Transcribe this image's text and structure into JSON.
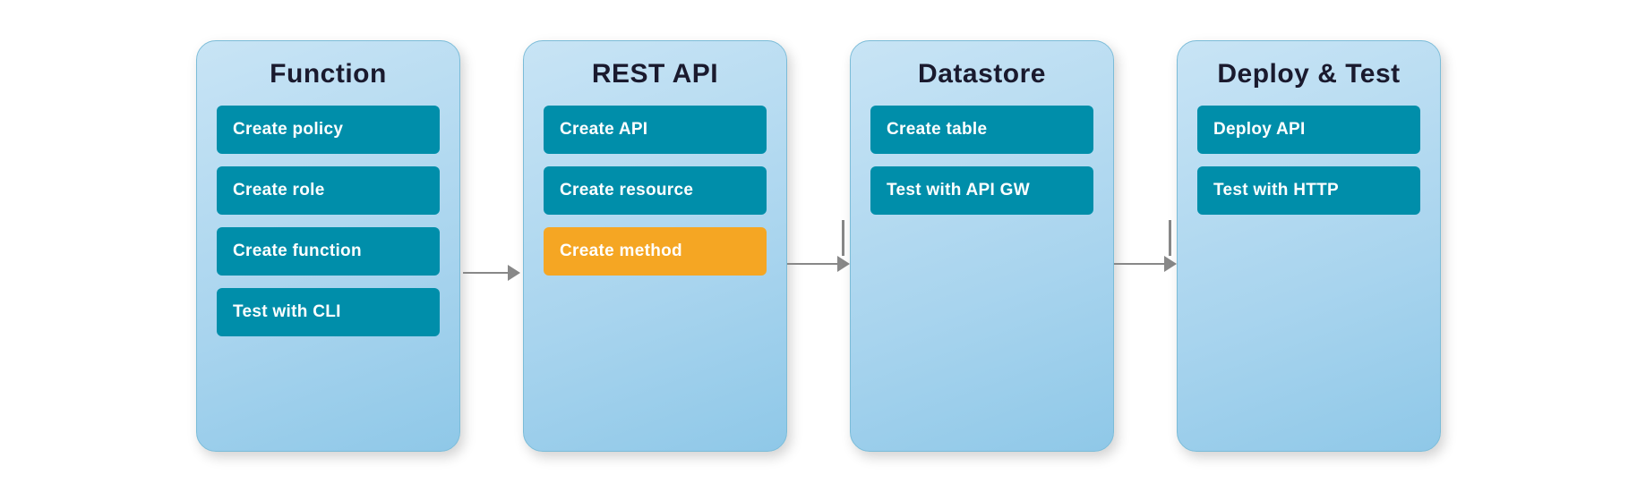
{
  "diagram": {
    "panels": [
      {
        "id": "function",
        "title": "Function",
        "items": [
          {
            "label": "Create policy",
            "color": "teal"
          },
          {
            "label": "Create role",
            "color": "teal"
          },
          {
            "label": "Create function",
            "color": "teal"
          },
          {
            "label": "Test with CLI",
            "color": "teal"
          }
        ]
      },
      {
        "id": "rest-api",
        "title": "REST API",
        "items": [
          {
            "label": "Create API",
            "color": "teal"
          },
          {
            "label": "Create resource",
            "color": "teal"
          },
          {
            "label": "Create method",
            "color": "orange"
          }
        ]
      },
      {
        "id": "datastore",
        "title": "Datastore",
        "items": [
          {
            "label": "Create table",
            "color": "teal"
          },
          {
            "label": "Test with API GW",
            "color": "teal"
          }
        ]
      },
      {
        "id": "deploy-test",
        "title": "Deploy & Test",
        "items": [
          {
            "label": "Deploy API",
            "color": "teal"
          },
          {
            "label": "Test with HTTP",
            "color": "teal"
          }
        ]
      }
    ],
    "arrows": [
      "straight",
      "elbow",
      "straight"
    ]
  }
}
